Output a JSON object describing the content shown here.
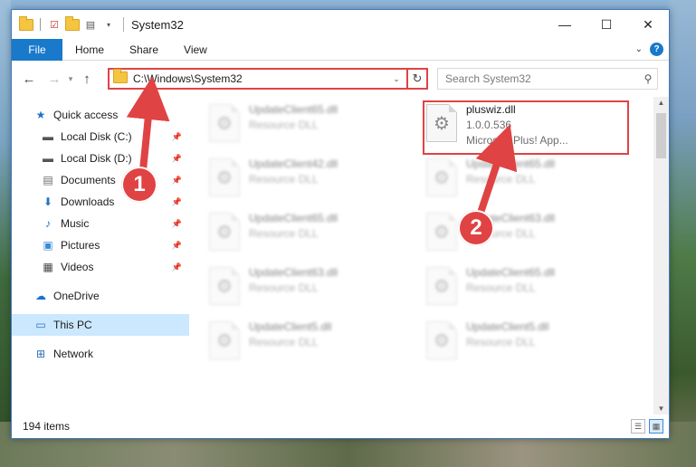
{
  "window": {
    "title": "System32",
    "controls": {
      "minimize": "—",
      "maximize": "☐",
      "close": "✕"
    }
  },
  "ribbon": {
    "tabs": [
      "File",
      "Home",
      "Share",
      "View"
    ],
    "help": "?",
    "expand": "⌄"
  },
  "address": {
    "path": "C:\\Windows\\System32",
    "search_placeholder": "Search System32"
  },
  "navpane": {
    "quick_access": "Quick access",
    "items": [
      {
        "label": "Local Disk (C:)",
        "icon": "drive-icon",
        "pinned": true
      },
      {
        "label": "Local Disk (D:)",
        "icon": "drive-icon",
        "pinned": true
      },
      {
        "label": "Documents",
        "icon": "documents-icon",
        "pinned": true
      },
      {
        "label": "Downloads",
        "icon": "download-icon",
        "pinned": true
      },
      {
        "label": "Music",
        "icon": "music-icon",
        "pinned": true
      },
      {
        "label": "Pictures",
        "icon": "pictures-icon",
        "pinned": true
      },
      {
        "label": "Videos",
        "icon": "videos-icon",
        "pinned": true
      }
    ],
    "onedrive": "OneDrive",
    "this_pc": "This PC",
    "network": "Network"
  },
  "files": {
    "left_column": [
      {
        "name": "UpdateClient65.dll",
        "desc": "Resource DLL"
      },
      {
        "name": "UpdateClient42.dll",
        "desc": "Resource DLL"
      },
      {
        "name": "UpdateClient65.dll",
        "desc": "Resource DLL"
      },
      {
        "name": "UpdateClient63.dll",
        "desc": "Resource DLL"
      },
      {
        "name": "UpdateClient5.dll",
        "desc": "Resource DLL"
      }
    ],
    "highlighted": {
      "name": "pluswiz.dll",
      "version": "1.0.0.536",
      "desc": "Microsoft Plus! App..."
    },
    "right_column": [
      {
        "name": "UpdateClient65.dll",
        "desc": "Resource DLL"
      },
      {
        "name": "UpdateClient63.dll",
        "desc": "Resource DLL"
      },
      {
        "name": "UpdateClient65.dll",
        "desc": "Resource DLL"
      },
      {
        "name": "UpdateClient5.dll",
        "desc": "Resource DLL"
      }
    ]
  },
  "status": {
    "item_count": "194 items"
  },
  "annotations": {
    "marker1": "1",
    "marker2": "2",
    "color": "#e04343"
  },
  "colors": {
    "accent": "#1979ca",
    "selection": "#cce8ff",
    "highlight": "#e04343"
  }
}
